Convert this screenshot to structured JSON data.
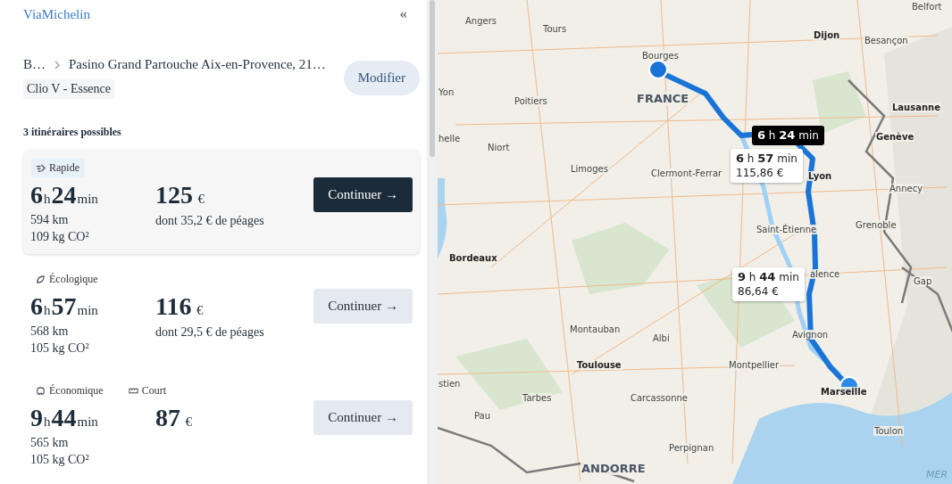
{
  "header": {
    "logo": "ViaMichelin",
    "collapse": "«"
  },
  "trip": {
    "origin": "B…",
    "destination": "Pasino Grand Partouche Aix-en-Provence, 21…",
    "vehicle": "Clio V - Essence",
    "edit_button": "Modifier"
  },
  "routes_title": "3 itinéraires possibles",
  "routes": [
    {
      "selected": true,
      "tags": [
        {
          "kind": "fast",
          "label": "Rapide"
        }
      ],
      "hours": "6",
      "hours_unit": "h",
      "minutes": "24",
      "minutes_unit": "min",
      "distance": "594 km",
      "co2": "109 kg CO²",
      "price": "125",
      "currency": "€",
      "tolls": "dont 35,2 € de péages",
      "button": "Continuer →"
    },
    {
      "selected": false,
      "tags": [
        {
          "kind": "eco",
          "label": "Écologique"
        }
      ],
      "hours": "6",
      "hours_unit": "h",
      "minutes": "57",
      "minutes_unit": "min",
      "distance": "568 km",
      "co2": "105 kg CO²",
      "price": "116",
      "currency": "€",
      "tolls": "dont 29,5 € de péages",
      "button": "Continuer →"
    },
    {
      "selected": false,
      "tags": [
        {
          "kind": "cheap",
          "label": "Économique"
        },
        {
          "kind": "short",
          "label": "Court"
        }
      ],
      "hours": "9",
      "hours_unit": "h",
      "minutes": "44",
      "minutes_unit": "min",
      "distance": "565 km",
      "co2": "105 kg CO²",
      "price": "87",
      "currency": "€",
      "button": "Continuer →"
    }
  ],
  "map": {
    "places": [
      {
        "kind": "city",
        "name": "Angers"
      },
      {
        "kind": "city",
        "name": "Tours"
      },
      {
        "kind": "major",
        "name": "Dijon"
      },
      {
        "kind": "city",
        "name": "Besançon"
      },
      {
        "kind": "city",
        "name": "Belfort"
      },
      {
        "kind": "city",
        "name": "Bourges"
      },
      {
        "kind": "city",
        "name": "Yon"
      },
      {
        "kind": "city",
        "name": "Poitiers"
      },
      {
        "kind": "country",
        "name": "FRANCE"
      },
      {
        "kind": "major",
        "name": "Lausanne"
      },
      {
        "kind": "city",
        "name": "helle"
      },
      {
        "kind": "city",
        "name": "Niort"
      },
      {
        "kind": "major",
        "name": "Genève"
      },
      {
        "kind": "city",
        "name": "Limoges"
      },
      {
        "kind": "city",
        "name": "Clermont-Ferrar"
      },
      {
        "kind": "major",
        "name": "Lyon"
      },
      {
        "kind": "city",
        "name": "Annecy"
      },
      {
        "kind": "city",
        "name": "Saint-Étienne"
      },
      {
        "kind": "city",
        "name": "Grenoble"
      },
      {
        "kind": "major",
        "name": "Bordeaux"
      },
      {
        "kind": "city",
        "name": "alence"
      },
      {
        "kind": "city",
        "name": "Gap"
      },
      {
        "kind": "city",
        "name": "Montauban"
      },
      {
        "kind": "city",
        "name": "Albi"
      },
      {
        "kind": "city",
        "name": "Avignon"
      },
      {
        "kind": "major",
        "name": "Toulouse"
      },
      {
        "kind": "city",
        "name": "Montpellier"
      },
      {
        "kind": "city",
        "name": "stien"
      },
      {
        "kind": "major",
        "name": "Marseille"
      },
      {
        "kind": "city",
        "name": "Tarbes"
      },
      {
        "kind": "city",
        "name": "Carcassonne"
      },
      {
        "kind": "city",
        "name": "Pau"
      },
      {
        "kind": "city",
        "name": "Toulon"
      },
      {
        "kind": "city",
        "name": "Perpignan"
      },
      {
        "kind": "country",
        "name": "ANDORRE"
      },
      {
        "kind": "sea",
        "name": "MER"
      }
    ],
    "callouts": [
      {
        "selected": true,
        "duration": "**6** h **24** min"
      },
      {
        "selected": false,
        "duration": "**6** h **57** min",
        "price": "115,86 €"
      },
      {
        "selected": false,
        "duration": "**9** h **44** min",
        "price": "86,64 €"
      }
    ]
  }
}
